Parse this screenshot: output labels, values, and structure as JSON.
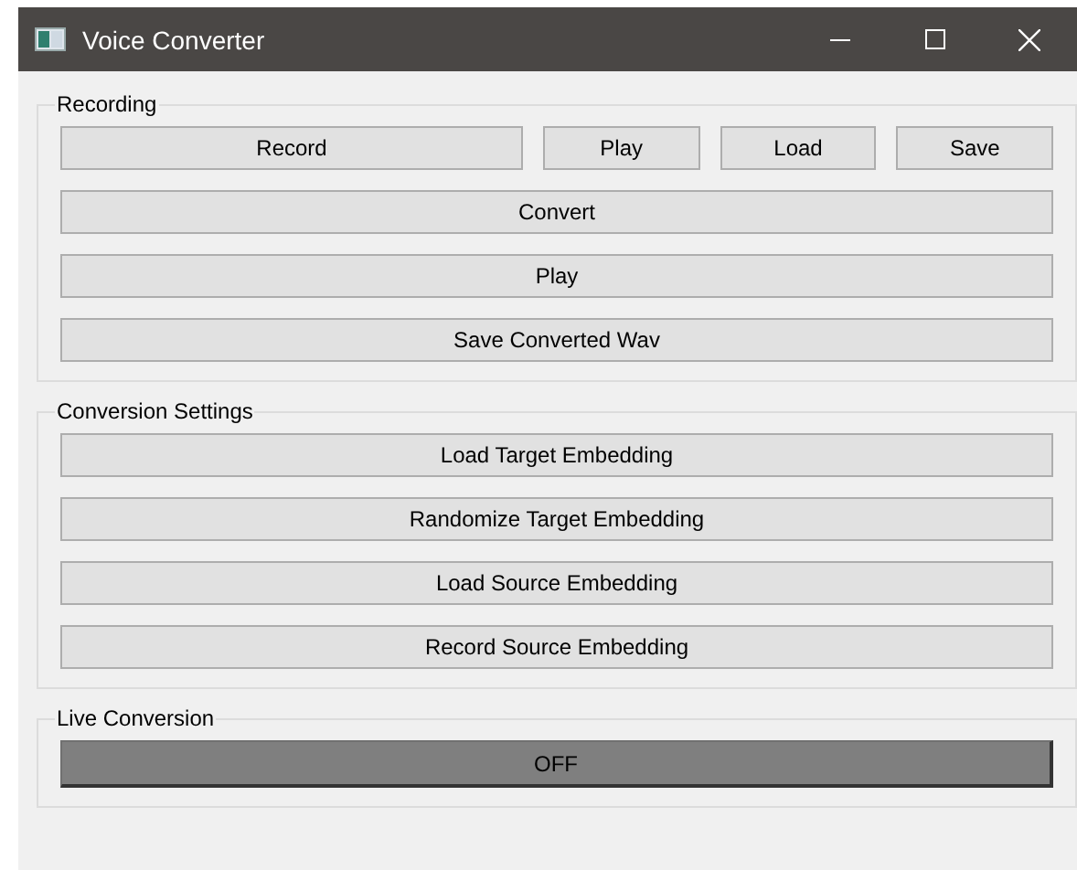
{
  "window": {
    "title": "Voice Converter"
  },
  "groups": [
    {
      "title": "Recording",
      "rows": [
        [
          {
            "label": "Record",
            "kind": "button"
          },
          {
            "label": "Play",
            "kind": "button"
          },
          {
            "label": "Load",
            "kind": "button"
          },
          {
            "label": "Save",
            "kind": "button"
          }
        ],
        [
          {
            "label": "Convert",
            "kind": "button"
          }
        ],
        [
          {
            "label": "Play",
            "kind": "button"
          }
        ],
        [
          {
            "label": "Save Converted Wav",
            "kind": "button"
          }
        ]
      ]
    },
    {
      "title": "Conversion Settings",
      "rows": [
        [
          {
            "label": "Load Target Embedding",
            "kind": "button"
          }
        ],
        [
          {
            "label": "Randomize Target Embedding",
            "kind": "button"
          }
        ],
        [
          {
            "label": "Load Source Embedding",
            "kind": "button"
          }
        ],
        [
          {
            "label": "Record Source Embedding",
            "kind": "button"
          }
        ]
      ]
    },
    {
      "title": "Live Conversion",
      "rows": [
        [
          {
            "label": "OFF",
            "kind": "toggle",
            "on": false
          }
        ]
      ]
    }
  ]
}
